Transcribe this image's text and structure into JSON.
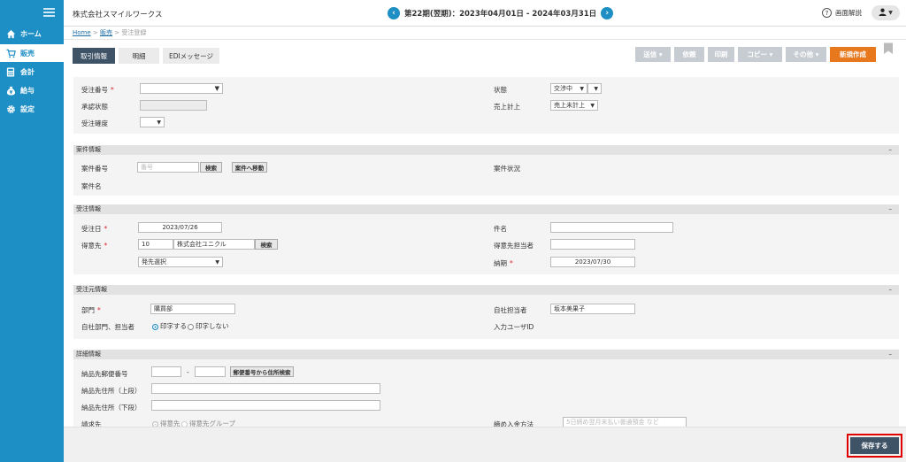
{
  "sidebar": {
    "items": [
      {
        "label": "ホーム",
        "icon": "home-icon"
      },
      {
        "label": "販売",
        "icon": "cart-icon"
      },
      {
        "label": "会計",
        "icon": "calculator-icon"
      },
      {
        "label": "給与",
        "icon": "money-bag-icon"
      },
      {
        "label": "設定",
        "icon": "gear-icon"
      }
    ]
  },
  "header": {
    "company": "株式会社スマイルワークス",
    "period": "第22期(翌期)：2023年04月01日 - 2024年03月31日",
    "help": "画面解説"
  },
  "breadcrumb": {
    "home": "Home",
    "sales": "販売",
    "sep": " > ",
    "current": "受注登録"
  },
  "tabs": [
    "取引情報",
    "明細",
    "EDIメッセージ"
  ],
  "toolbar": {
    "send": "送信 ▾",
    "request": "依頼",
    "print": "印刷",
    "copy": "コピー ▾",
    "other": "その他 ▾",
    "new": "新規作成"
  },
  "top": {
    "order_no_label": "受注番号",
    "approval_label": "承認状態",
    "certainty_label": "受注確度",
    "status_label": "状態",
    "status_value": "交渉中",
    "sales_label": "売上計上",
    "sales_value": "売上未計上"
  },
  "project": {
    "title": "案件情報",
    "no_label": "案件番号",
    "no_placeholder": "番号",
    "search": "検索",
    "goto": "案件へ移動",
    "name_label": "案件名",
    "status_label": "案件状況"
  },
  "order": {
    "title": "受注情報",
    "date_label": "受注日",
    "date_value": "2023/07/26",
    "customer_label": "得意先",
    "customer_code": "10",
    "customer_name": "株式会社ユニクル",
    "search": "検索",
    "dest_select": "発先選択",
    "subject_label": "件名",
    "contact_label": "得意先担当者",
    "due_label": "納期",
    "due_value": "2023/07/30"
  },
  "source": {
    "title": "受注元情報",
    "dept_label": "部門",
    "dept_value": "購買部",
    "staff_label": "自社担当者",
    "staff_value": "坂本美果子",
    "print_label": "自社部門、担当者",
    "print_yes": "印字する",
    "print_no": "印字しない",
    "input_user_label": "入力ユーザID"
  },
  "detail": {
    "title": "詳細情報",
    "zip_label": "納品先郵便番号",
    "zip_dash": "-",
    "zip_search": "郵便番号から住所検索",
    "addr1_label": "納品先住所（上段）",
    "addr2_label": "納品先住所（下段）",
    "billing_label": "請求先",
    "billing_opt1": "得意先",
    "billing_opt2": "得意先グループ",
    "closing_label": "締め入金方法",
    "closing_placeholder": "5日締め翌月末払い普通預金 など"
  },
  "collapse_symbol": "–",
  "save": "保存する",
  "colors": {
    "sidebar": "#1e8fc4",
    "primary": "#3f5366",
    "accent": "#e8781e",
    "required": "#d9272e"
  }
}
